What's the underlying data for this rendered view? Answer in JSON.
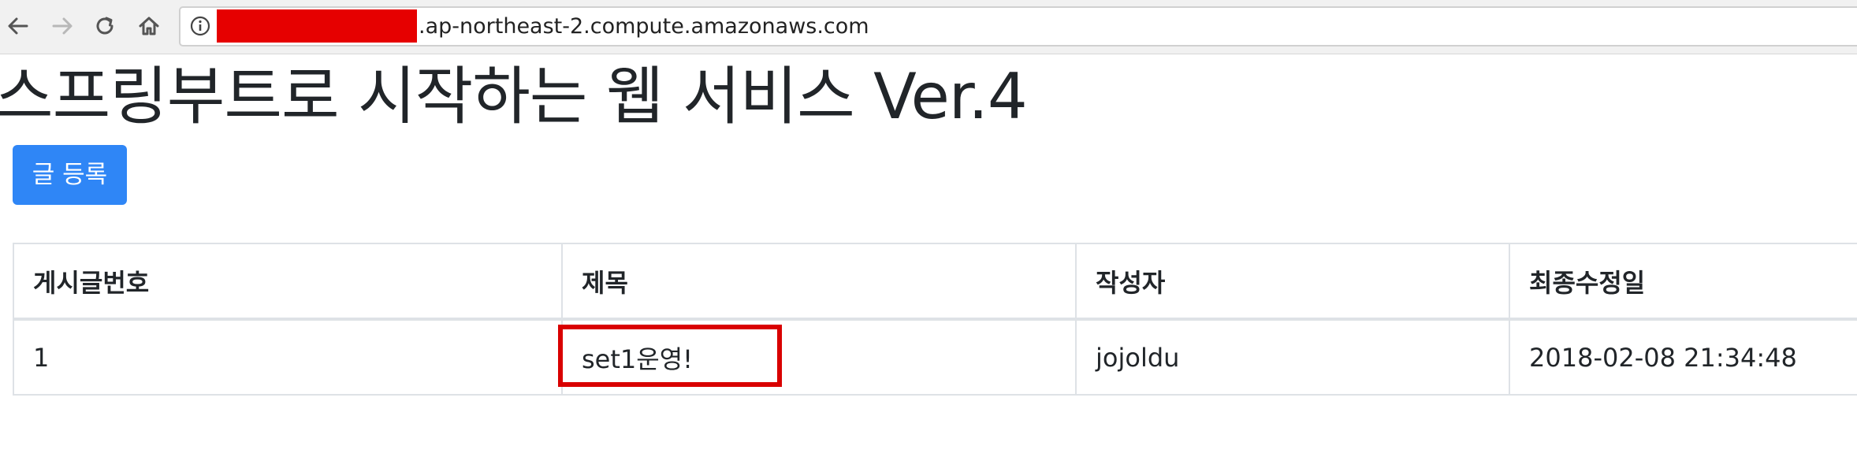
{
  "browser": {
    "url_suffix": ".ap-northeast-2.compute.amazonaws.com",
    "url_redacted": true,
    "redaction_color": "#e60000",
    "nav_icons": [
      "back-arrow-icon",
      "forward-arrow-icon",
      "reload-icon",
      "home-icon",
      "info-icon"
    ]
  },
  "page": {
    "title": "스프링부트로 시작하는 웹 서비스 Ver.4",
    "register_button_label": "글 등록",
    "accent_color": "#2f86f6"
  },
  "table": {
    "headers": [
      "게시글번호",
      "제목",
      "작성자",
      "최종수정일"
    ],
    "rows": [
      {
        "id": "1",
        "title": "set1운영!",
        "author": "jojoldu",
        "modified": "2018-02-08 21:34:48"
      }
    ]
  },
  "annotation": {
    "highlight_color": "#d90000",
    "highlighted_cell": "title"
  }
}
